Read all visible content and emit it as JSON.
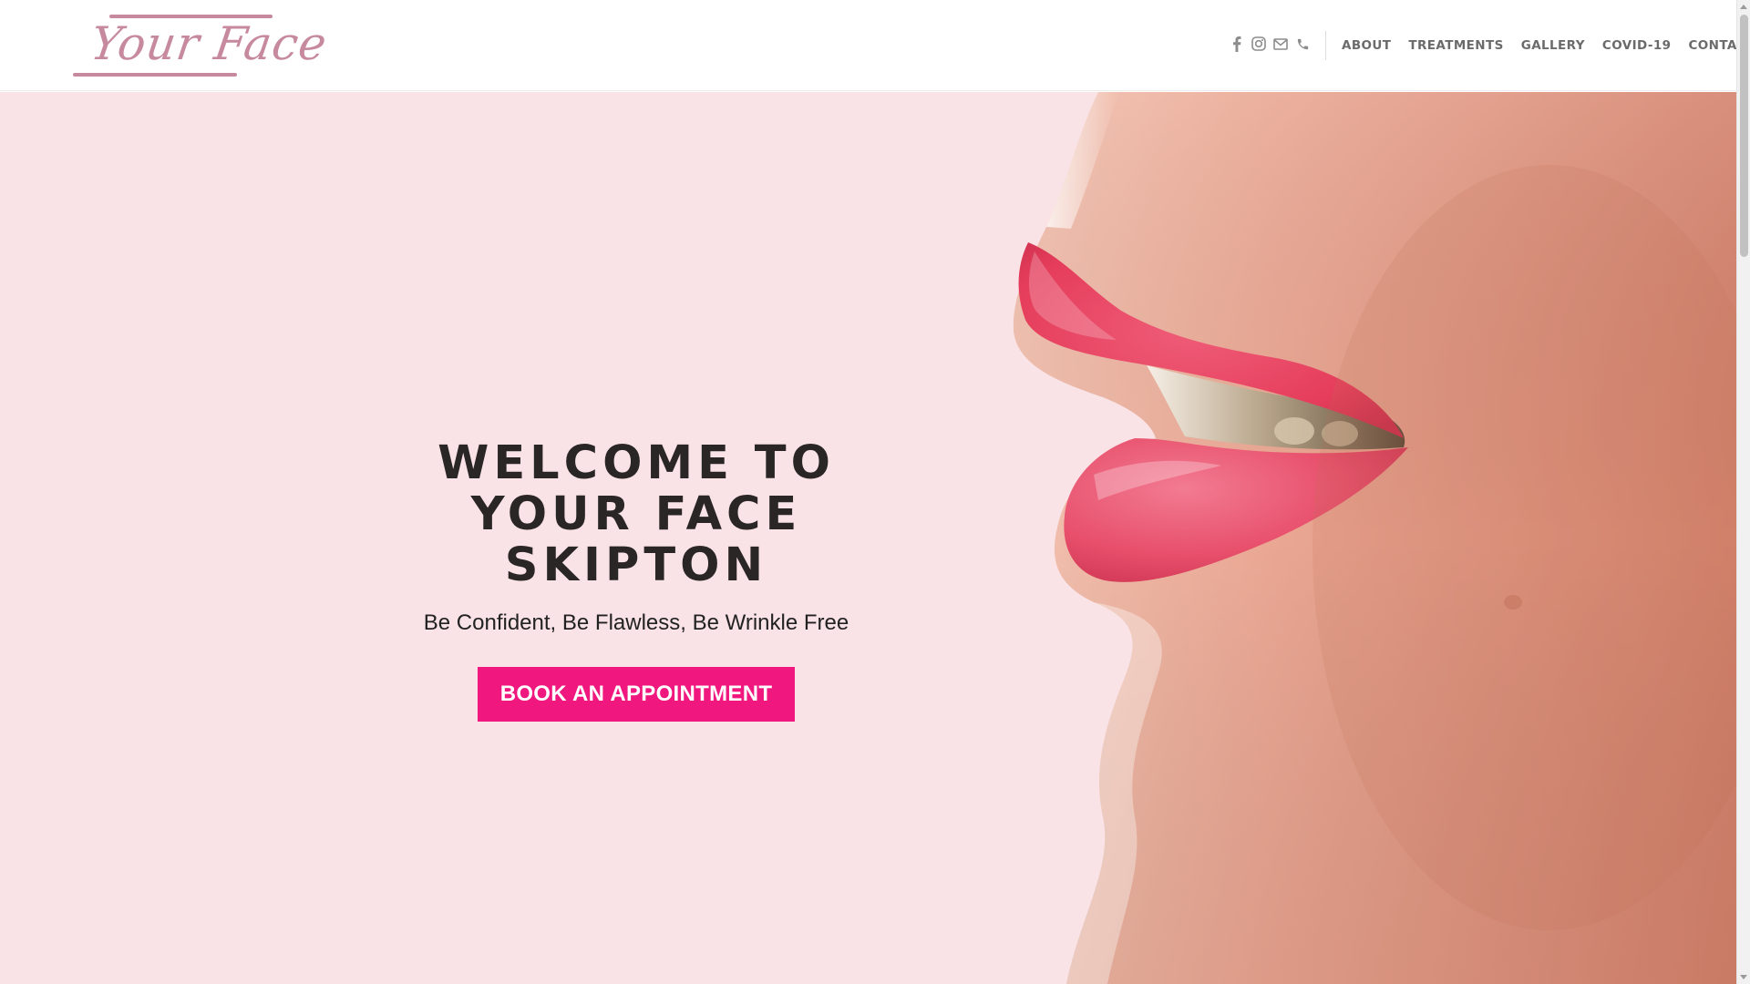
{
  "header": {
    "logo_text": "Your Face",
    "social_icons": [
      "facebook-icon",
      "instagram-icon",
      "email-icon",
      "phone-icon"
    ],
    "nav": {
      "about": "ABOUT",
      "treatments": "TREATMENTS",
      "gallery": "GALLERY",
      "covid": "COVID-19",
      "contact": "CONTACT"
    }
  },
  "hero": {
    "title": "WELCOME TO YOUR FACE SKIPTON",
    "subtitle": "Be Confident, Be Flawless, Be Wrinkle Free",
    "cta_label": "BOOK AN APPOINTMENT",
    "image": "lips-closeup-photo"
  },
  "colors": {
    "brand_mauve": "#c7899d",
    "cta_pink": "#f0187e",
    "hero_background": "#f9e3e6",
    "heading_dark": "#2b2626",
    "nav_grey": "#6b6b6b"
  }
}
